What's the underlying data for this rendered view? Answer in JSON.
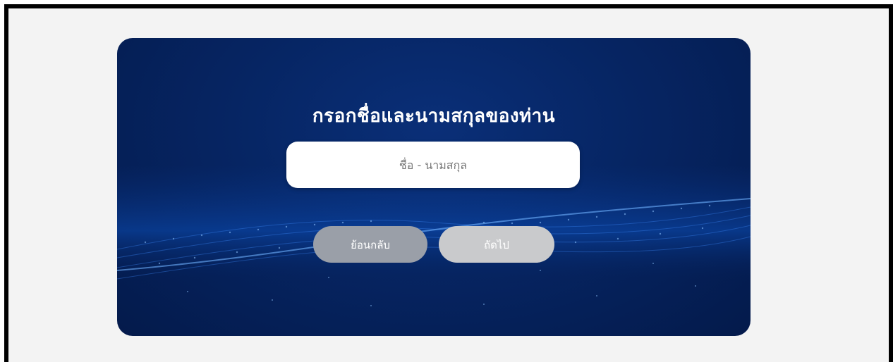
{
  "form": {
    "title": "กรอกชื่อและนามสกุลของท่าน",
    "name_placeholder": "ชื่อ - นามสกุล",
    "name_value": ""
  },
  "buttons": {
    "back_label": "ย้อนกลับ",
    "next_label": "ถัดไป"
  },
  "colors": {
    "card_background": "#062563",
    "back_button": "#9a9fa8",
    "next_button": "#c9cacc",
    "input_background": "#ffffff"
  }
}
